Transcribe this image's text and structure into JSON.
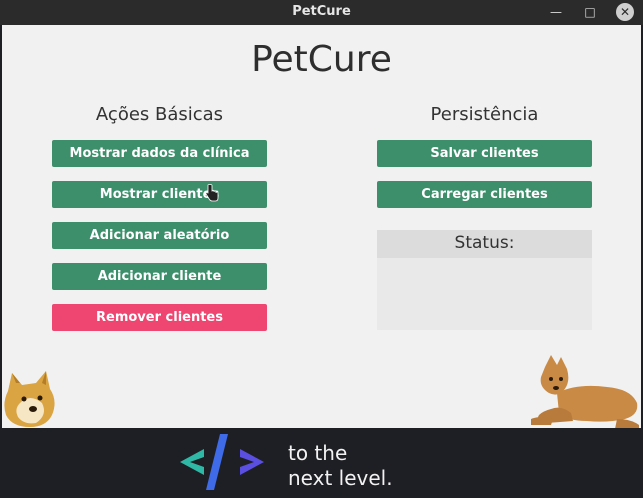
{
  "window": {
    "title": "PetCure"
  },
  "app": {
    "title": "PetCure"
  },
  "left": {
    "title": "Ações Básicas",
    "buttons": [
      "Mostrar dados da clínica",
      "Mostrar clientes",
      "Adicionar aleatório",
      "Adicionar cliente",
      "Remover clientes"
    ]
  },
  "right": {
    "title": "Persistência",
    "buttons": [
      "Salvar clientes",
      "Carregar clientes"
    ],
    "status_label": "Status:"
  },
  "banner": {
    "line1": "to the",
    "line2": "next level."
  },
  "colors": {
    "primary_button": "#3d8f6b",
    "danger_button": "#ef4571"
  },
  "icons": [
    "minimize-icon",
    "maximize-icon",
    "close-icon",
    "cursor-icon",
    "code-logo-icon"
  ]
}
